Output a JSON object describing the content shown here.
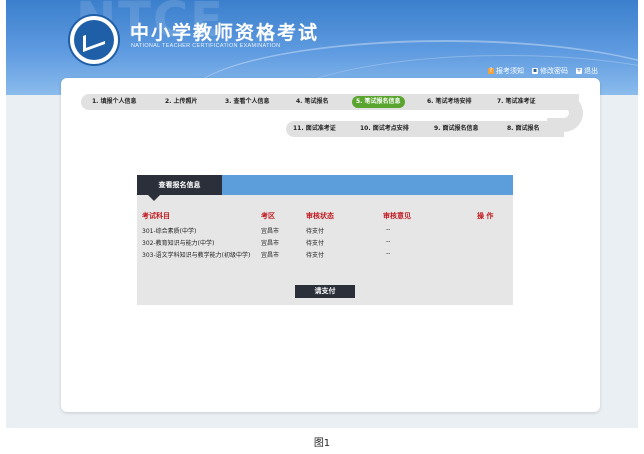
{
  "header": {
    "site_title": "中小学教师资格考试",
    "site_subtitle": "NATIONAL TEACHER CERTIFICATION EXAMINATION",
    "links": [
      {
        "label": "报考须知",
        "icon": "question-icon"
      },
      {
        "label": "修改密码",
        "icon": "password-icon"
      },
      {
        "label": "退出",
        "icon": "exit-icon"
      }
    ]
  },
  "steps": {
    "row1": [
      "1. 填报个人信息",
      "2. 上传照片",
      "3. 查看个人信息",
      "4. 笔试报名",
      "5. 笔试报名信息",
      "6. 笔试考场安排",
      "7. 笔试准考证"
    ],
    "row2": [
      "11. 面试准考证",
      "10. 面试考点安排",
      "9. 面试报名信息",
      "8. 面试报名"
    ],
    "active_index": 4
  },
  "panel": {
    "title": "查看报名信息",
    "columns": [
      "考试科目",
      "考区",
      "审核状态",
      "审核意见",
      "操 作"
    ],
    "rows": [
      {
        "subject": "301-综合素质(中学)",
        "region": "宜昌市",
        "status": "待支付",
        "opinion": "--",
        "action": ""
      },
      {
        "subject": "302-教育知识与能力(中学)",
        "region": "宜昌市",
        "status": "待支付",
        "opinion": "--",
        "action": ""
      },
      {
        "subject": "303-语文学科知识与教学能力(初级中学)",
        "region": "宜昌市",
        "status": "待支付",
        "opinion": "--",
        "action": ""
      }
    ],
    "pay_button": "请支付"
  },
  "caption": "图1",
  "colors": {
    "header_blue": "#3b7fcc",
    "active_step": "#5aa52f",
    "table_header_red": "#c0191f",
    "panel_dark": "#2a2f3a"
  }
}
